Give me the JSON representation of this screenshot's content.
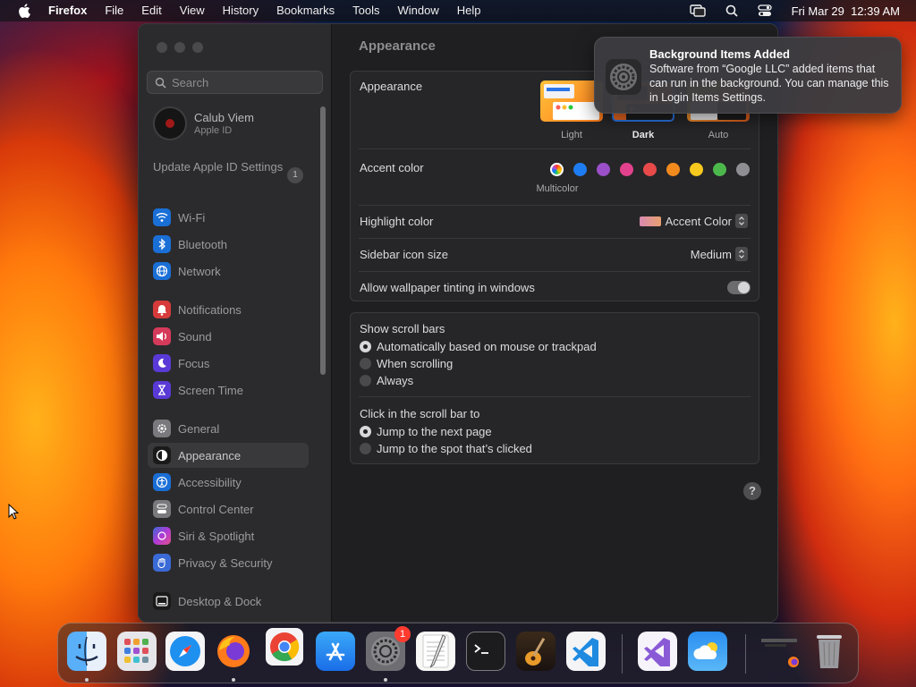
{
  "menubar": {
    "app_name": "Firefox",
    "menus": [
      "File",
      "Edit",
      "View",
      "History",
      "Bookmarks",
      "Tools",
      "Window",
      "Help"
    ],
    "datetime": "Fri Mar 29  12:39 AM",
    "status_icons": [
      "screen-mirroring-icon",
      "search-icon",
      "control-center-icon"
    ]
  },
  "sidebar": {
    "search_placeholder": "Search",
    "profile": {
      "name": "Calub Viem",
      "subtitle": "Apple ID"
    },
    "update": {
      "label": "Update Apple ID Settings",
      "badge": "1"
    },
    "items": [
      {
        "label": "Wi-Fi",
        "icon": "wifi-icon",
        "color": "#1a6fd6"
      },
      {
        "label": "Bluetooth",
        "icon": "bluetooth-icon",
        "color": "#1a6fd6"
      },
      {
        "label": "Network",
        "icon": "network-icon",
        "color": "#1a6fd6"
      },
      {
        "label": "Notifications",
        "icon": "notifications-icon",
        "color": "#d63a3a"
      },
      {
        "label": "Sound",
        "icon": "sound-icon",
        "color": "#d63a5a"
      },
      {
        "label": "Focus",
        "icon": "focus-icon",
        "color": "#5a3ad6"
      },
      {
        "label": "Screen Time",
        "icon": "screen-time-icon",
        "color": "#5a3ad6"
      },
      {
        "label": "General",
        "icon": "general-icon",
        "color": "#7a7a7e"
      },
      {
        "label": "Appearance",
        "icon": "appearance-icon",
        "color": "#1a1a1a"
      },
      {
        "label": "Accessibility",
        "icon": "accessibility-icon",
        "color": "#1a6fd6"
      },
      {
        "label": "Control Center",
        "icon": "control-center-icon",
        "color": "#7a7a7e"
      },
      {
        "label": "Siri & Spotlight",
        "icon": "siri-icon",
        "color": "#b03ad6"
      },
      {
        "label": "Privacy & Security",
        "icon": "privacy-icon",
        "color": "#3a6ad6"
      },
      {
        "label": "Desktop & Dock",
        "icon": "desktop-dock-icon",
        "color": "#1a1a1a"
      }
    ]
  },
  "content": {
    "title": "Appearance",
    "appearance": {
      "label": "Appearance",
      "options": [
        {
          "label": "Light"
        },
        {
          "label": "Dark",
          "selected": true
        },
        {
          "label": "Auto"
        }
      ]
    },
    "accent": {
      "label": "Accent color",
      "colors": [
        "multicolor",
        "#1e7cf2",
        "#9b4fc8",
        "#e2428d",
        "#e84a4a",
        "#f28a1e",
        "#f7c81e",
        "#4cb84c",
        "#8e8e93"
      ],
      "selected_name": "Multicolor"
    },
    "highlight": {
      "label": "Highlight color",
      "value": "Accent Color"
    },
    "sidebar_icon_size": {
      "label": "Sidebar icon size",
      "value": "Medium"
    },
    "wallpaper_tinting": {
      "label": "Allow wallpaper tinting in windows",
      "enabled": true
    },
    "scroll_bars": {
      "label": "Show scroll bars",
      "options": [
        "Automatically based on mouse or trackpad",
        "When scrolling",
        "Always"
      ],
      "selected": 0
    },
    "click_scroll": {
      "label": "Click in the scroll bar to",
      "options": [
        "Jump to the next page",
        "Jump to the spot that’s clicked"
      ],
      "selected": 0
    },
    "help": "?"
  },
  "notification": {
    "title": "Background Items Added",
    "body": "Software from “Google LLC” added items that can run in the background. You can manage this in Login Items Settings."
  },
  "dock": {
    "apps": [
      {
        "name": "Finder",
        "icon": "finder-icon",
        "running": true
      },
      {
        "name": "Launchpad",
        "icon": "launchpad-icon"
      },
      {
        "name": "Safari",
        "icon": "safari-icon"
      },
      {
        "name": "Firefox",
        "icon": "firefox-icon",
        "running": true
      },
      {
        "name": "Chrome",
        "icon": "chrome-icon"
      },
      {
        "name": "App Store",
        "icon": "app-store-icon"
      },
      {
        "name": "System Settings",
        "icon": "system-settings-icon",
        "running": true,
        "badge": "1"
      },
      {
        "name": "TextEdit",
        "icon": "textedit-icon"
      },
      {
        "name": "Terminal",
        "icon": "terminal-icon"
      },
      {
        "name": "GarageBand",
        "icon": "garageband-icon"
      },
      {
        "name": "Visual Studio Code",
        "icon": "vscode-icon"
      },
      {
        "name": "Visual Studio",
        "icon": "visual-studio-icon"
      },
      {
        "name": "Weather",
        "icon": "weather-icon"
      },
      {
        "name": "Downloads",
        "icon": "downloads-stack-icon"
      },
      {
        "name": "Trash",
        "icon": "trash-icon"
      }
    ]
  }
}
